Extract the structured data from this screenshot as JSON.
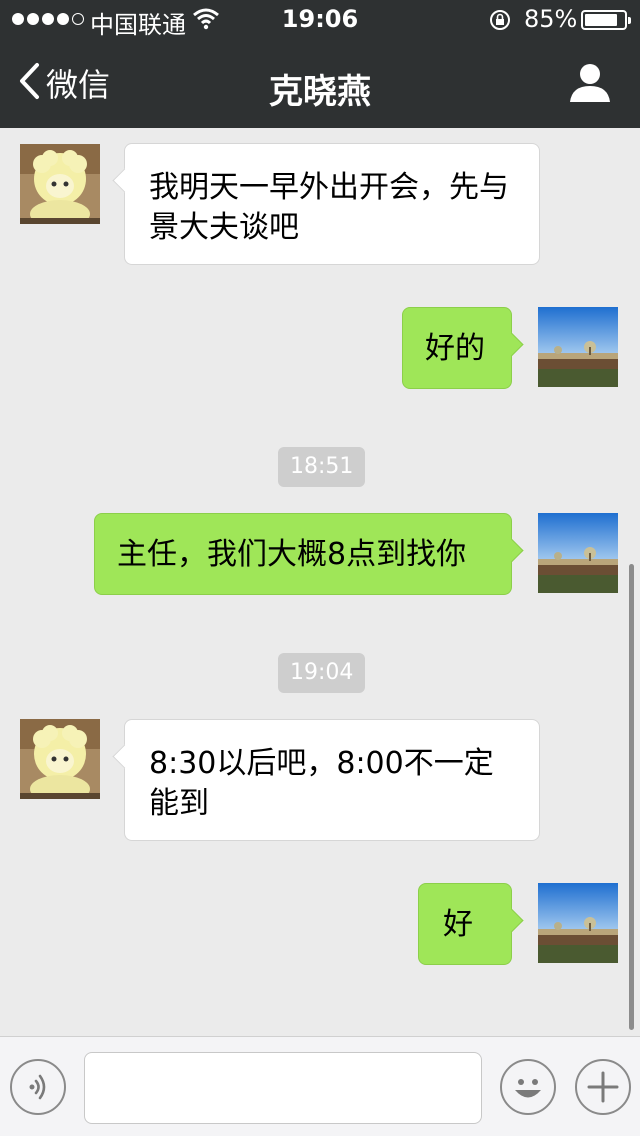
{
  "status_bar": {
    "carrier": "中国联通",
    "time": "19:06",
    "battery_percent": "85%",
    "battery_level": 0.85,
    "signal_bars": 4
  },
  "nav": {
    "back_label": "微信",
    "title": "克晓燕",
    "icons": {
      "back": "chevron-left-icon",
      "profile": "person-icon"
    }
  },
  "messages": [
    {
      "side": "left",
      "text": "我明天一早外出开会，先与景大夫谈吧"
    },
    {
      "side": "right",
      "text": "好的"
    },
    {
      "type": "timestamp",
      "text": "18:51"
    },
    {
      "side": "right",
      "text": "主任，我们大概8点到找你"
    },
    {
      "type": "timestamp",
      "text": "19:04"
    },
    {
      "side": "left",
      "text": "8:30以后吧，8:00不一定能到"
    },
    {
      "side": "right",
      "text": "好"
    }
  ],
  "input_bar": {
    "value": "",
    "icons": [
      "voice-icon",
      "emoji-icon",
      "plus-icon"
    ]
  },
  "colors": {
    "nav_background": "#2e3132",
    "chat_background": "#ebebeb",
    "sent_bubble": "#9fe658",
    "received_bubble": "#ffffff",
    "timestamp_background": "#cecece"
  }
}
